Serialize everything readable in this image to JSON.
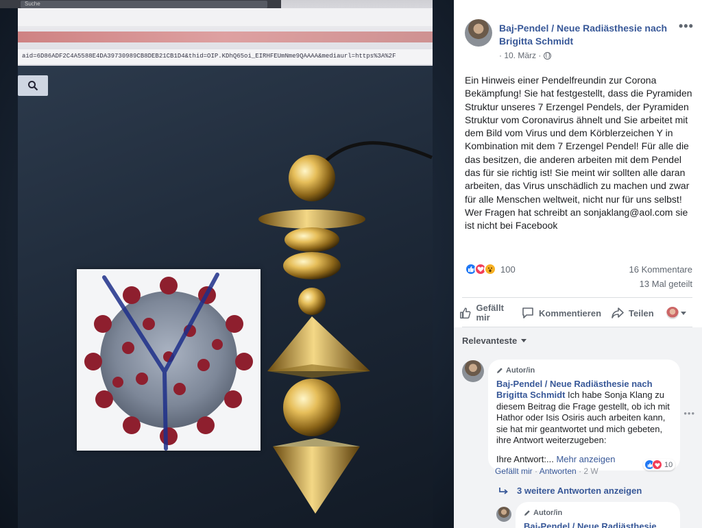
{
  "browser": {
    "search_text": "Suche",
    "url_fragment": "aid=6D86ADF2C4A5588E4DA39730989CB8DEB21CB1D4&thid=OIP.KDhQ65oi_EIRHFEUmNme9QAAAA&mediaurl=https%3A%2F"
  },
  "post": {
    "author": "Baj-Pendel / Neue Radiästhesie nach Brigitta Schmidt",
    "date": "· 10. März ·",
    "more": "•••",
    "text": "Ein Hinweis einer Pendelfreundin zur Corona Bekämpfung! Sie hat festgestellt, dass die Pyramiden Struktur unseres 7 Erzengel Pendels, der Pyramiden Struktur vom Coronavirus ähnelt und Sie arbeitet mit dem Bild vom Virus und dem Körblerzeichen Y in Kombination mit dem 7 Erzengel Pendel! Für alle die das besitzen, die anderen arbeiten mit dem Pendel das für sie richtig ist! Sie meint wir sollten alle daran arbeiten, das Virus unschädlich zu machen und zwar für alle Menschen weltweit, nicht nur für uns selbst! Wer Fragen hat schreibt an sonjaklang@aol.com sie ist nicht bei Facebook",
    "reactions_count": "100",
    "comments_count": "16 Kommentare",
    "shares_count": "13 Mal geteilt"
  },
  "actions": {
    "like": "Gefällt mir",
    "comment": "Kommentieren",
    "share": "Teilen"
  },
  "comments": {
    "sort_label": "Relevanteste",
    "first": {
      "badge": "Autor/in",
      "name": "Baj-Pendel / Neue Radiästhesie nach Brigitta Schmidt",
      "text": " Ich habe Sonja Klang zu diesem Beitrag die Frage gestellt, ob ich mit Hathor oder Isis Osiris auch arbeiten kann, sie hat mir geantwortet und mich gebeten, ihre Antwort weiterzugeben:",
      "text2": "Ihre Antwort:...",
      "more_link": "Mehr anzeigen",
      "reactions": "10",
      "like": "Gefällt mir",
      "reply": "Antworten",
      "age": "2 W",
      "more": "•••"
    },
    "replies_link": "3 weitere Antworten anzeigen",
    "second": {
      "badge": "Autor/in",
      "name": "Baj-Pendel / Neue Radiästhesie"
    }
  },
  "colors": {
    "link_blue": "#385898",
    "like_blue": "#2078f4",
    "love_red": "#f33e58",
    "wow_yellow": "#f7b125"
  }
}
